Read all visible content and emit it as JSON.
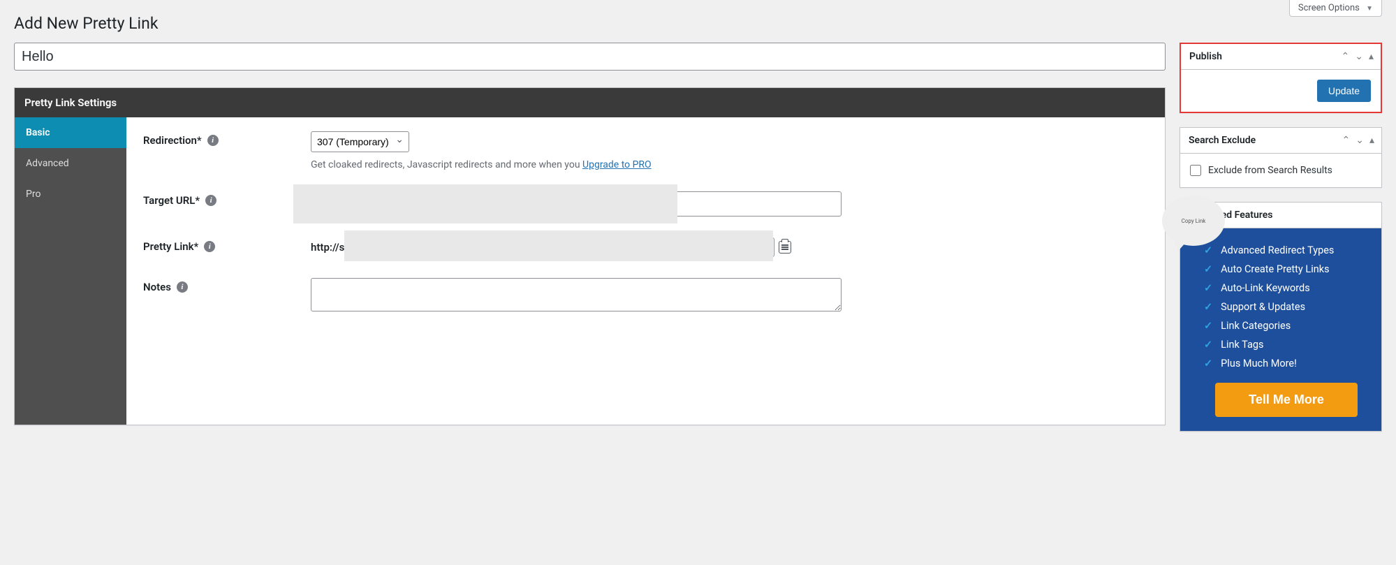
{
  "screen_options_label": "Screen Options",
  "page_title": "Add New Pretty Link",
  "title_value": "Hello",
  "settings": {
    "header": "Pretty Link Settings",
    "tabs": {
      "basic": "Basic",
      "advanced": "Advanced",
      "pro": "Pro"
    },
    "redirection": {
      "label": "Redirection*",
      "select_value": "307 (Temporary)",
      "helper_prefix": "Get cloaked redirects, Javascript redirects and more when you ",
      "helper_link": "Upgrade to PRO"
    },
    "target_url": {
      "label": "Target URL*"
    },
    "pretty_link": {
      "label": "Pretty Link*",
      "prefix": "http://s",
      "tooltip": "Copy Link"
    },
    "notes": {
      "label": "Notes"
    }
  },
  "sidebar": {
    "publish": {
      "title": "Publish",
      "button": "Update"
    },
    "search_exclude": {
      "title": "Search Exclude",
      "checkbox_label": "Exclude from Search Results"
    },
    "advanced_features": {
      "title": "Advanced Features",
      "items": [
        "Advanced Redirect Types",
        "Auto Create Pretty Links",
        "Auto-Link Keywords",
        "Support & Updates",
        "Link Categories",
        "Link Tags",
        "Plus Much More!"
      ],
      "cta": "Tell Me More"
    }
  }
}
